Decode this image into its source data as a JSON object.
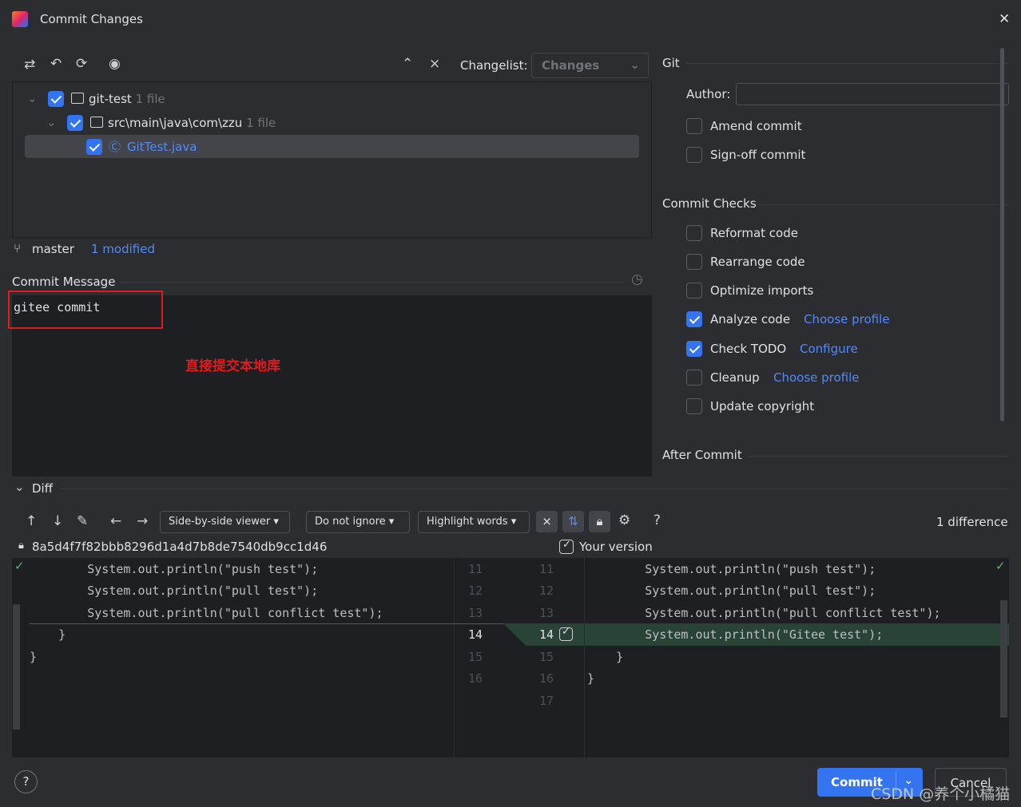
{
  "window": {
    "title": "Commit Changes",
    "close": "✕"
  },
  "toolbar": {
    "changelist_label": "Changelist:",
    "changelist_value": "Changes"
  },
  "tree": [
    {
      "label": "git-test",
      "count": "1 file"
    },
    {
      "label": "src\\main\\java\\com\\zzu",
      "count": "1 file"
    },
    {
      "label": "GitTest.java"
    }
  ],
  "status": {
    "branch": "master",
    "modified": "1 modified"
  },
  "commit_message": {
    "label": "Commit Message",
    "value": "gitee commit",
    "annotation": "直接提交本地库"
  },
  "git": {
    "section": "Git",
    "author_label": "Author:",
    "author_value": "",
    "amend": "Amend commit",
    "signoff": "Sign-off commit"
  },
  "checks": {
    "section": "Commit Checks",
    "items": [
      {
        "label": "Reformat code",
        "checked": false
      },
      {
        "label": "Rearrange code",
        "checked": false
      },
      {
        "label": "Optimize imports",
        "checked": false
      },
      {
        "label": "Analyze code",
        "checked": true,
        "link": "Choose profile"
      },
      {
        "label": "Check TODO",
        "checked": true,
        "link": "Configure"
      },
      {
        "label": "Cleanup",
        "checked": false,
        "link": "Choose profile"
      },
      {
        "label": "Update copyright",
        "checked": false
      }
    ]
  },
  "after_commit": "After Commit",
  "diff": {
    "label": "Diff",
    "viewer": "Side-by-side viewer",
    "ignore": "Do not ignore",
    "highlight": "Highlight words",
    "help": "?",
    "count": "1 difference",
    "left_hash": "8a5d4f7f82bbb8296d1a4d7b8de7540db9cc1d46",
    "right_label": "Your version",
    "left_lines": [
      "        System.out.println(\"push test\");",
      "        System.out.println(\"pull test\");",
      "        System.out.println(\"pull conflict test\");",
      "    }",
      "}"
    ],
    "right_lines": [
      "        System.out.println(\"push test\");",
      "        System.out.println(\"pull test\");",
      "        System.out.println(\"pull conflict test\");",
      "        System.out.println(\"Gitee test\");",
      "    }",
      "}",
      ""
    ],
    "left_nums": [
      "11",
      "12",
      "13",
      "14",
      "15",
      "16"
    ],
    "right_nums": [
      "11",
      "12",
      "13",
      "14",
      "15",
      "16",
      "17"
    ]
  },
  "buttons": {
    "commit": "Commit",
    "cancel": "Cancel",
    "help": "?"
  },
  "watermark": "CSDN @养个小橘猫"
}
